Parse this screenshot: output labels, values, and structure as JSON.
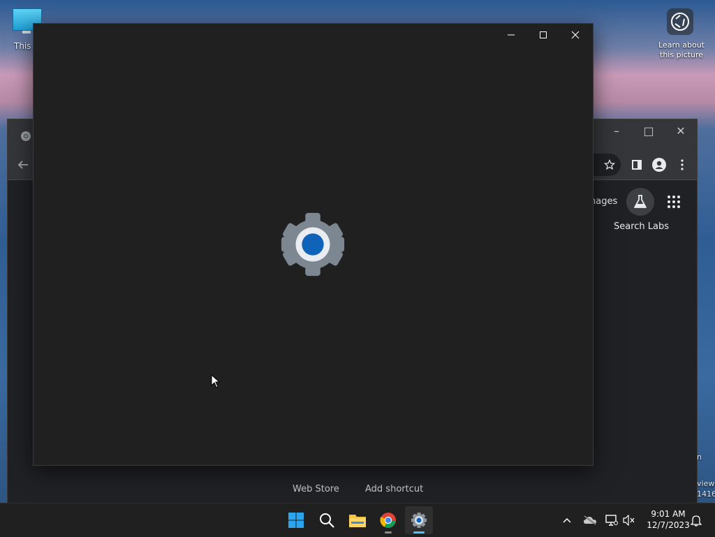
{
  "desktop": {
    "this_pc_label": "This F",
    "learn_picture_label": "Learn about this picture",
    "right_fragment_1": "n",
    "right_fragment_2": "view",
    "right_fragment_3": "1416"
  },
  "chrome": {
    "images_link": "nages",
    "search_labs_label": "Search Labs",
    "shortcuts": [
      {
        "label": "Web Store"
      },
      {
        "label": "Add shortcut"
      }
    ]
  },
  "settings_window": {
    "caption": {
      "minimize": "–",
      "maximize": "□",
      "close": "✕"
    }
  },
  "taskbar": {
    "clock_time": "9:01 AM",
    "clock_date": "12/7/2023"
  },
  "colors": {
    "accent": "#4cc2ff",
    "gear_center": "#0f63b8",
    "splash_bg": "#202020"
  }
}
